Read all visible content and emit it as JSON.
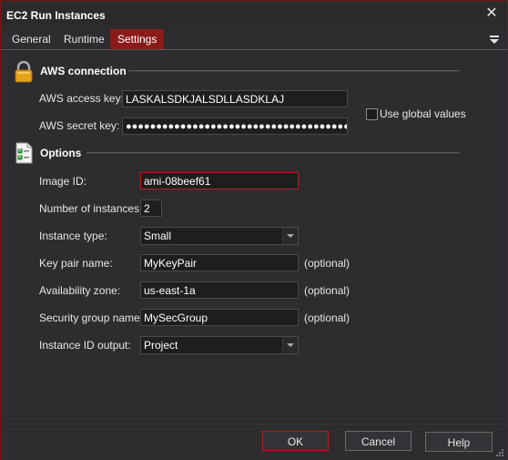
{
  "window": {
    "title": "EC2 Run Instances"
  },
  "tabs": [
    {
      "label": "General",
      "active": false
    },
    {
      "label": "Runtime",
      "active": false
    },
    {
      "label": "Settings",
      "active": true
    }
  ],
  "aws_connection": {
    "title": "AWS connection",
    "access_key_label": "AWS access key:",
    "access_key_value": "LASKALSDKJALSDLLASDKLAJ",
    "secret_key_label": "AWS secret key:",
    "secret_key_value": "●●●●●●●●●●●●●●●●●●●●●●●●●●●●●●●●●●●●●●●●●●",
    "use_global_label": "Use global values",
    "use_global_checked": false
  },
  "options": {
    "title": "Options",
    "image_id_label": "Image ID:",
    "image_id_value": "ami-08beef61",
    "num_instances_label": "Number of instances:",
    "num_instances_value": "2",
    "instance_type_label": "Instance type:",
    "instance_type_value": "Small",
    "key_pair_label": "Key pair name:",
    "key_pair_value": "MyKeyPair",
    "availability_zone_label": "Availability zone:",
    "availability_zone_value": "us-east-1a",
    "security_group_label": "Security group name:",
    "security_group_value": "MySecGroup",
    "instance_id_output_label": "Instance ID output:",
    "instance_id_output_value": "Project",
    "optional_text": "(optional)"
  },
  "footer": {
    "ok_label": "OK",
    "cancel_label": "Cancel",
    "help_label": "Help"
  },
  "colors": {
    "accent": "#8b1a1a",
    "background": "#2d2d30",
    "input_background": "#1e1e1e"
  }
}
